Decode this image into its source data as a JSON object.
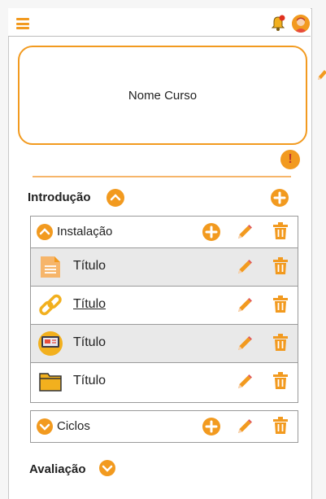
{
  "header": {
    "menu_icon": "hamburger-icon",
    "notification_icon": "bell-icon",
    "avatar_icon": "user-avatar"
  },
  "course": {
    "name": "Nome Curso"
  },
  "info_button": "!",
  "sections": [
    {
      "title": "Introdução",
      "expanded": true,
      "groups": [
        {
          "title": "Instalação",
          "expanded": true,
          "items": [
            {
              "title": "Título",
              "type": "document",
              "link": false,
              "highlighted": true
            },
            {
              "title": "Título",
              "type": "link",
              "link": true,
              "highlighted": false
            },
            {
              "title": "Título",
              "type": "presentation",
              "link": false,
              "highlighted": true
            },
            {
              "title": "Título",
              "type": "folder",
              "link": false,
              "highlighted": false
            }
          ]
        },
        {
          "title": "Ciclos",
          "expanded": false,
          "items": []
        }
      ]
    },
    {
      "title": "Avaliação",
      "expanded": false,
      "groups": []
    }
  ],
  "colors": {
    "accent": "#f29a1f",
    "row_highlight": "#e9e9e9",
    "divider": "#f6b56a"
  }
}
